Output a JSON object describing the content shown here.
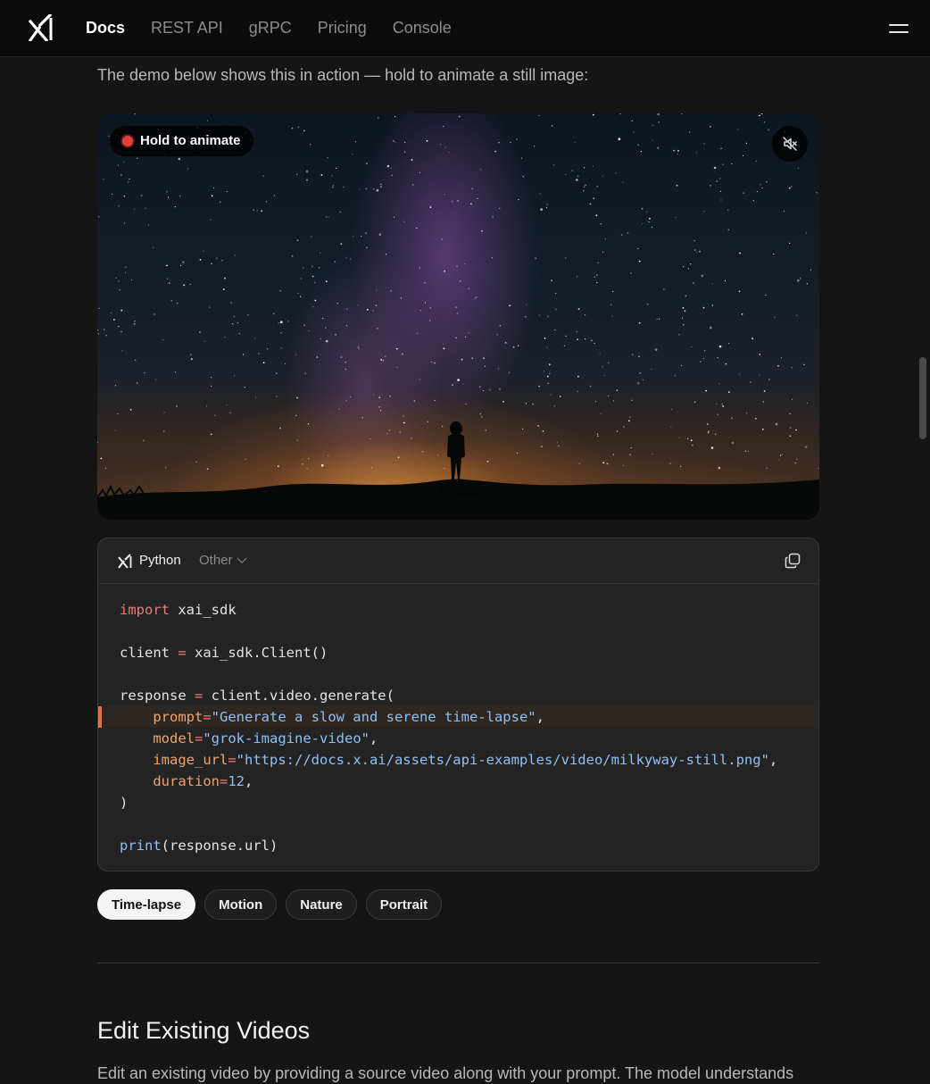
{
  "header": {
    "nav": [
      {
        "label": "Docs",
        "active": true
      },
      {
        "label": "REST API",
        "active": false
      },
      {
        "label": "gRPC",
        "active": false
      },
      {
        "label": "Pricing",
        "active": false
      },
      {
        "label": "Console",
        "active": false
      }
    ],
    "logo_icon": "xai-logo-icon",
    "menu_icon": "hamburger-menu-icon"
  },
  "intro_text": "The demo below shows this in action — hold to animate a still image:",
  "demo": {
    "hold_label": "Hold to animate",
    "record_indicator_color": "#e0413f",
    "mute_icon": "speaker-muted-icon"
  },
  "code_block": {
    "lang_selected": "Python",
    "lang_other": "Other",
    "copy_icon": "copy-icon",
    "highlight_color": "#e0733f",
    "lines": [
      {
        "tokens": [
          {
            "t": "import",
            "c": "kw"
          },
          {
            "t": " xai_sdk",
            "c": ""
          }
        ]
      },
      {
        "tokens": []
      },
      {
        "tokens": [
          {
            "t": "client ",
            "c": ""
          },
          {
            "t": "=",
            "c": "op"
          },
          {
            "t": " xai_sdk.Client()",
            "c": ""
          }
        ]
      },
      {
        "tokens": []
      },
      {
        "tokens": [
          {
            "t": "response ",
            "c": ""
          },
          {
            "t": "=",
            "c": "op"
          },
          {
            "t": " client.video.generate(",
            "c": ""
          }
        ]
      },
      {
        "hl": true,
        "tokens": [
          {
            "t": "    prompt",
            "c": "attr"
          },
          {
            "t": "=",
            "c": "op"
          },
          {
            "t": "\"Generate a slow and serene time-lapse\"",
            "c": "str"
          },
          {
            "t": ",",
            "c": ""
          }
        ]
      },
      {
        "tokens": [
          {
            "t": "    model",
            "c": "attr"
          },
          {
            "t": "=",
            "c": "op"
          },
          {
            "t": "\"grok-imagine-video\"",
            "c": "str"
          },
          {
            "t": ",",
            "c": ""
          }
        ]
      },
      {
        "tokens": [
          {
            "t": "    image_url",
            "c": "attr"
          },
          {
            "t": "=",
            "c": "op"
          },
          {
            "t": "\"https://docs.x.ai/assets/api-examples/video/milkyway-still.png\"",
            "c": "str"
          },
          {
            "t": ",",
            "c": ""
          }
        ]
      },
      {
        "tokens": [
          {
            "t": "    duration",
            "c": "attr"
          },
          {
            "t": "=",
            "c": "op"
          },
          {
            "t": "12",
            "c": "num"
          },
          {
            "t": ",",
            "c": ""
          }
        ]
      },
      {
        "tokens": [
          {
            "t": ")",
            "c": ""
          }
        ]
      },
      {
        "tokens": []
      },
      {
        "tokens": [
          {
            "t": "print",
            "c": "fn"
          },
          {
            "t": "(response.url)",
            "c": ""
          }
        ]
      }
    ]
  },
  "chips": [
    {
      "label": "Time-lapse",
      "active": true
    },
    {
      "label": "Motion",
      "active": false
    },
    {
      "label": "Nature",
      "active": false
    },
    {
      "label": "Portrait",
      "active": false
    }
  ],
  "section": {
    "heading": "Edit Existing Videos",
    "paragraph": "Edit an existing video by providing a source video along with your prompt. The model understands"
  }
}
